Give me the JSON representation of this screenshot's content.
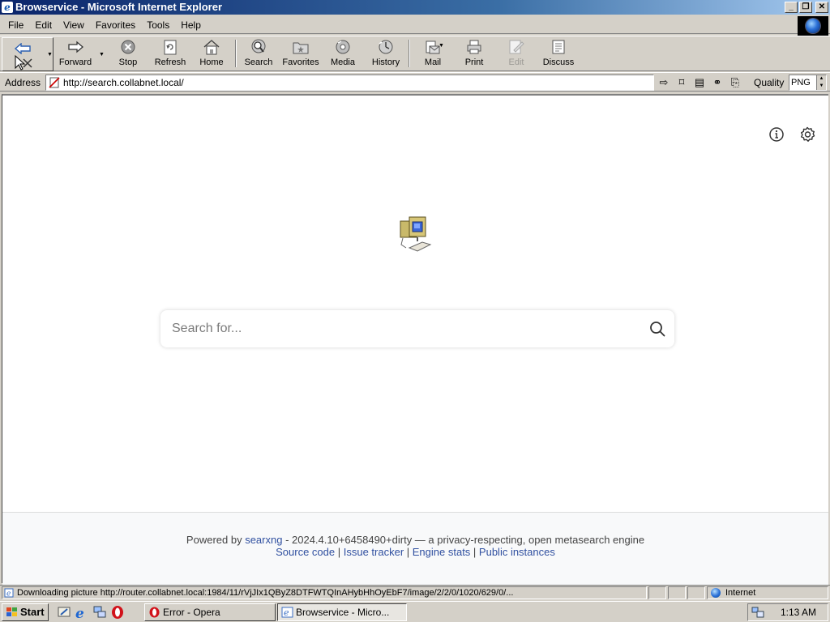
{
  "window": {
    "title": "Browservice - Microsoft Internet Explorer",
    "minimize_glyph": "_",
    "maximize_glyph": "❐",
    "close_glyph": "✕"
  },
  "menubar": {
    "items": [
      {
        "label": "File",
        "icon": "none"
      },
      {
        "label": "Edit"
      },
      {
        "label": "View"
      },
      {
        "label": "Favorites"
      },
      {
        "label": "Tools"
      },
      {
        "label": "Help"
      }
    ]
  },
  "toolbar": {
    "back_label": "",
    "forward_label": "Forward",
    "stop_label": "Stop",
    "refresh_label": "Refresh",
    "home_label": "Home",
    "search_label": "Search",
    "favorites_label": "Favorites",
    "media_label": "Media",
    "history_label": "History",
    "mail_label": "Mail",
    "print_label": "Print",
    "edit_label": "Edit",
    "discuss_label": "Discuss"
  },
  "addressbar": {
    "label": "Address",
    "url": "http://search.collabnet.local/",
    "quality_label": "Quality",
    "quality_value": "PNG"
  },
  "page": {
    "search": {
      "placeholder": "Search for..."
    },
    "footer": {
      "powered_by": "Powered by",
      "engine_link": "searxng",
      "version_text": " - 2024.4.10+6458490+dirty — a privacy-respecting, open metasearch engine",
      "links": [
        "Source code",
        "Issue tracker",
        "Engine stats",
        "Public instances"
      ],
      "separator": " | "
    }
  },
  "statusbar": {
    "text": "Downloading picture http://router.collabnet.local:1984/11/rVjJIx1QByZ8DTFWTQInAHybHhOyEbF7/image/2/2/0/1020/629/0/...",
    "zone": "Internet"
  },
  "taskbar": {
    "start_label": "Start",
    "tasks": [
      {
        "label": "Error - Opera",
        "active": false
      },
      {
        "label": "Browservice - Micro...",
        "active": true
      }
    ],
    "clock": "1:13 AM"
  },
  "colors": {
    "titlebar_start": "#0a246a",
    "titlebar_end": "#a6caf0",
    "link": "#3050a0",
    "chrome": "#d4d0c8"
  }
}
